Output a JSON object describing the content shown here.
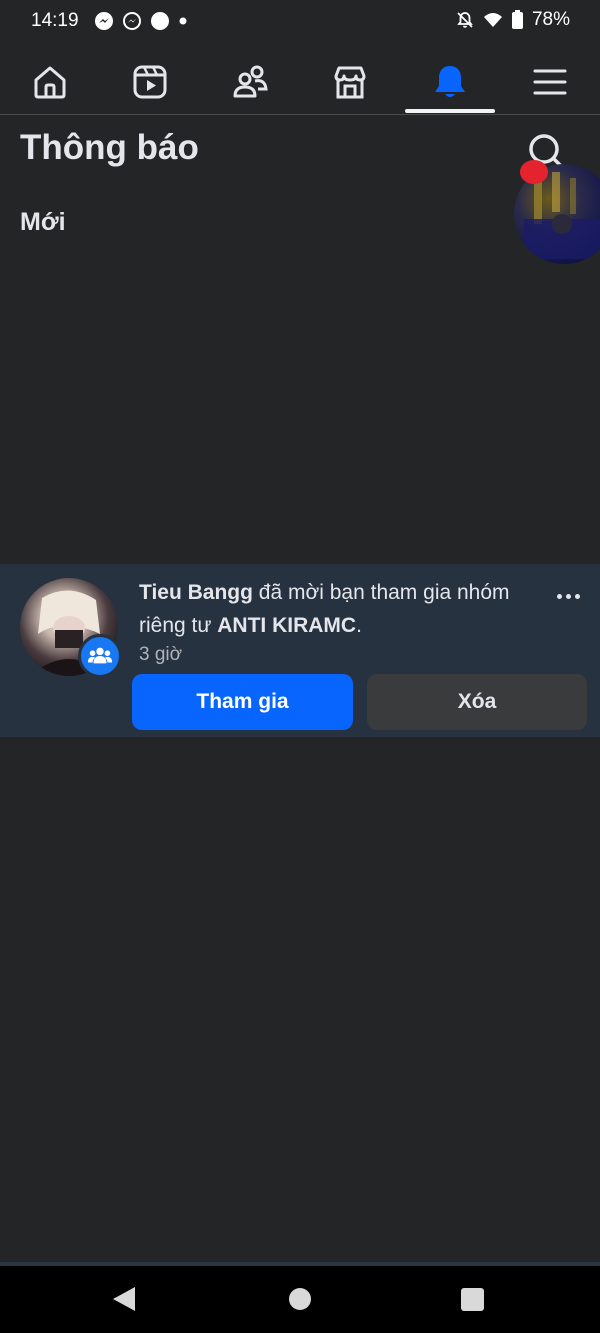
{
  "status_bar": {
    "time": "14:19",
    "battery": "78%",
    "left_icons": [
      "messenger-icon",
      "messenger-outline-icon",
      "dot-icon",
      "small-dot-icon"
    ],
    "right_icons": [
      "bell-muted-icon",
      "wifi-icon",
      "battery-icon"
    ]
  },
  "nav": {
    "tabs": [
      {
        "name": "home-icon",
        "active": false
      },
      {
        "name": "video-icon",
        "active": false
      },
      {
        "name": "friends-icon",
        "active": false
      },
      {
        "name": "marketplace-icon",
        "active": false
      },
      {
        "name": "bell-icon",
        "active": true
      },
      {
        "name": "menu-icon",
        "active": false
      }
    ],
    "active_color": "#0866ff"
  },
  "header": {
    "title": "Thông báo",
    "section": "Mới"
  },
  "notification": {
    "actor": "Tieu Bangg",
    "text_middle": " đã mời bạn tham gia nhóm riêng tư ",
    "group": "ANTI KIRAMC",
    "text_end": ".",
    "time": "3 giờ",
    "join_label": "Tham gia",
    "delete_label": "Xóa"
  },
  "colors": {
    "background": "#242526",
    "unread_row": "#263240",
    "primary": "#0866ff"
  }
}
